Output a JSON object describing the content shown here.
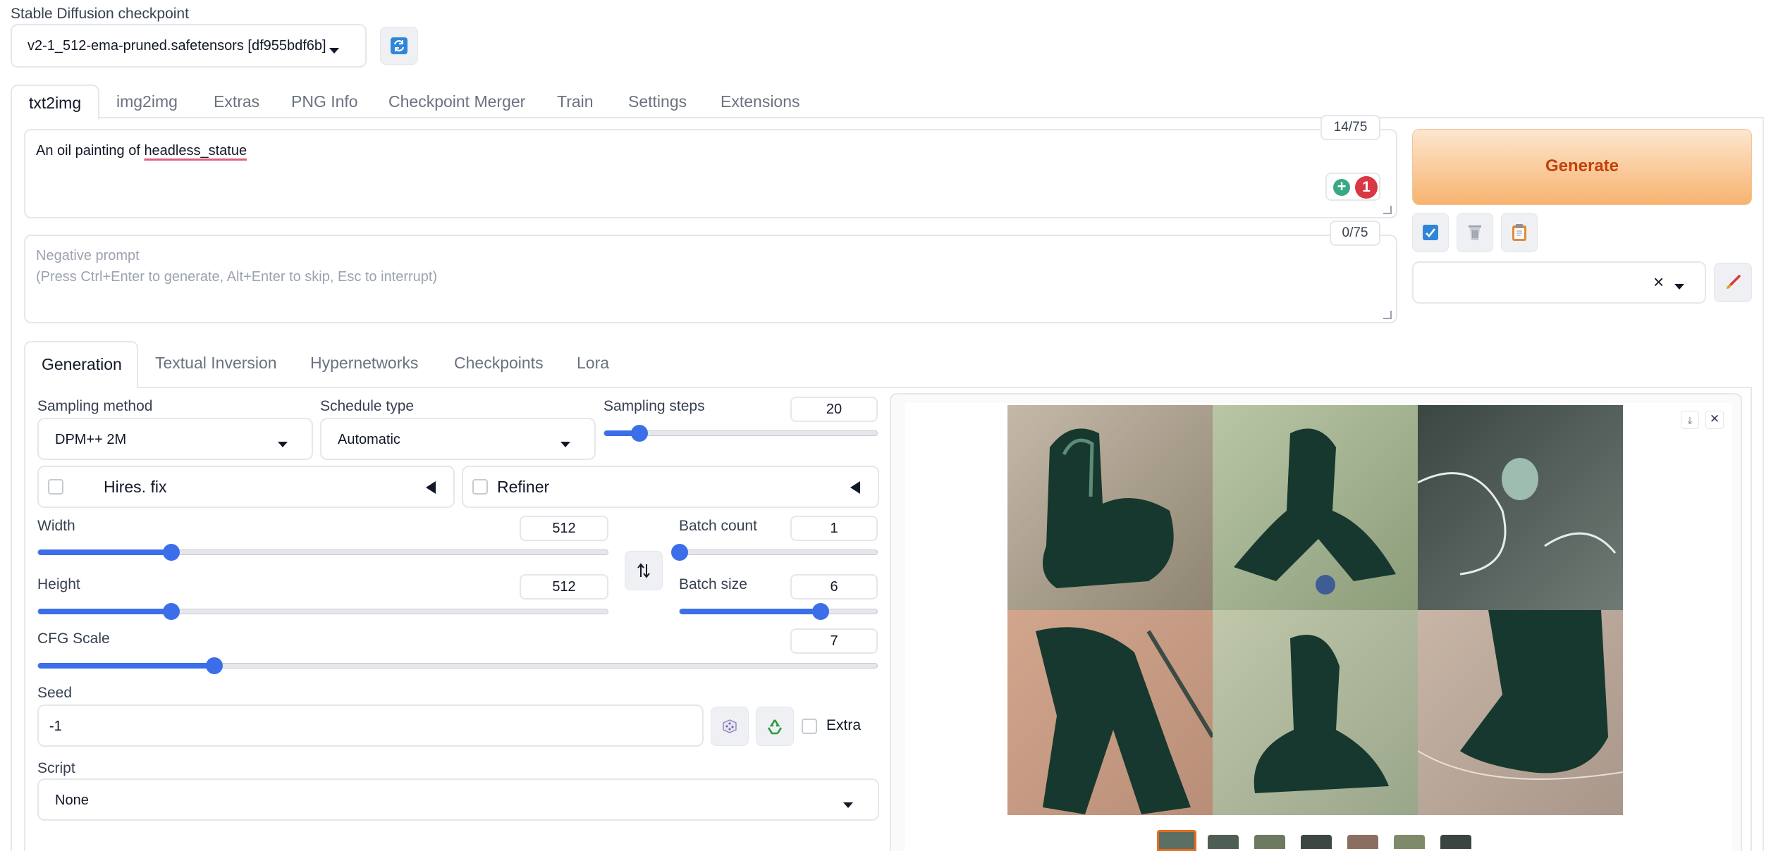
{
  "checkpoint": {
    "label": "Stable Diffusion checkpoint",
    "value": "v2-1_512-ema-pruned.safetensors [df955bdf6b]"
  },
  "main_tabs": [
    "txt2img",
    "img2img",
    "Extras",
    "PNG Info",
    "Checkpoint Merger",
    "Train",
    "Settings",
    "Extensions"
  ],
  "prompt": {
    "text_prefix": "An oil painting of ",
    "text_token": "headless_statue",
    "token_count": "14/75",
    "badge_count": "1"
  },
  "negative_prompt": {
    "placeholder_line1": "Negative prompt",
    "placeholder_line2": "(Press Ctrl+Enter to generate, Alt+Enter to skip, Esc to interrupt)",
    "token_count": "0/75"
  },
  "generate_label": "Generate",
  "styles_clear": "×",
  "sub_tabs": [
    "Generation",
    "Textual Inversion",
    "Hypernetworks",
    "Checkpoints",
    "Lora"
  ],
  "sampling_method": {
    "label": "Sampling method",
    "value": "DPM++ 2M"
  },
  "schedule_type": {
    "label": "Schedule type",
    "value": "Automatic"
  },
  "sampling_steps": {
    "label": "Sampling steps",
    "value": "20",
    "fraction": 0.13
  },
  "hires_fix": {
    "label": "Hires. fix",
    "checked": false
  },
  "refiner": {
    "label": "Refiner",
    "checked": false
  },
  "width": {
    "label": "Width",
    "value": "512",
    "fraction": 0.234
  },
  "height": {
    "label": "Height",
    "value": "512",
    "fraction": 0.234
  },
  "batch_count": {
    "label": "Batch count",
    "value": "1",
    "fraction": 0.0
  },
  "batch_size": {
    "label": "Batch size",
    "value": "6",
    "fraction": 0.714
  },
  "cfg_scale": {
    "label": "CFG Scale",
    "value": "7",
    "fraction": 0.21
  },
  "seed": {
    "label": "Seed",
    "value": "-1",
    "extra_label": "Extra"
  },
  "script": {
    "label": "Script",
    "value": "None"
  },
  "colors": {
    "accent": "#3b6ee8",
    "generate_from": "#fde6cf",
    "generate_to": "#f7b36f",
    "generate_text": "#c2410c"
  }
}
